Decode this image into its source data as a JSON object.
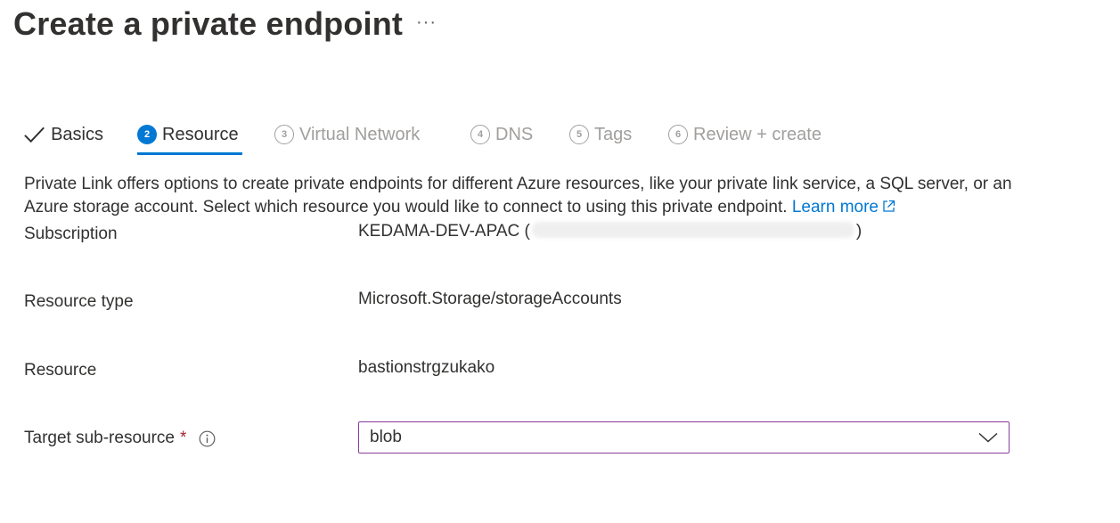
{
  "page": {
    "title": "Create a private endpoint",
    "more_label": "···"
  },
  "tabs": [
    {
      "step": "",
      "label": "Basics",
      "state": "done"
    },
    {
      "step": "2",
      "label": "Resource",
      "state": "active"
    },
    {
      "step": "3",
      "label": "Virtual Network",
      "state": "pending"
    },
    {
      "step": "4",
      "label": "DNS",
      "state": "pending"
    },
    {
      "step": "5",
      "label": "Tags",
      "state": "pending"
    },
    {
      "step": "6",
      "label": "Review + create",
      "state": "pending"
    }
  ],
  "description": {
    "text": "Private Link offers options to create private endpoints for different Azure resources, like your private link service, a SQL server, or an Azure storage account. Select which resource you would like to connect to using this private endpoint.",
    "link_label": "Learn more"
  },
  "form": {
    "subscription": {
      "label": "Subscription",
      "value_prefix": "KEDAMA-DEV-APAC (",
      "value_suffix": ")"
    },
    "resource_type": {
      "label": "Resource type",
      "value": "Microsoft.Storage/storageAccounts"
    },
    "resource": {
      "label": "Resource",
      "value": "bastionstrgzukako"
    },
    "target_sub_resource": {
      "label": "Target sub-resource",
      "required_mark": "*",
      "value": "blob"
    }
  },
  "colors": {
    "accent": "#0078d4",
    "required": "#a4262c",
    "dropdown_border": "#8a3c9c",
    "disabled_text": "#a19f9d"
  }
}
